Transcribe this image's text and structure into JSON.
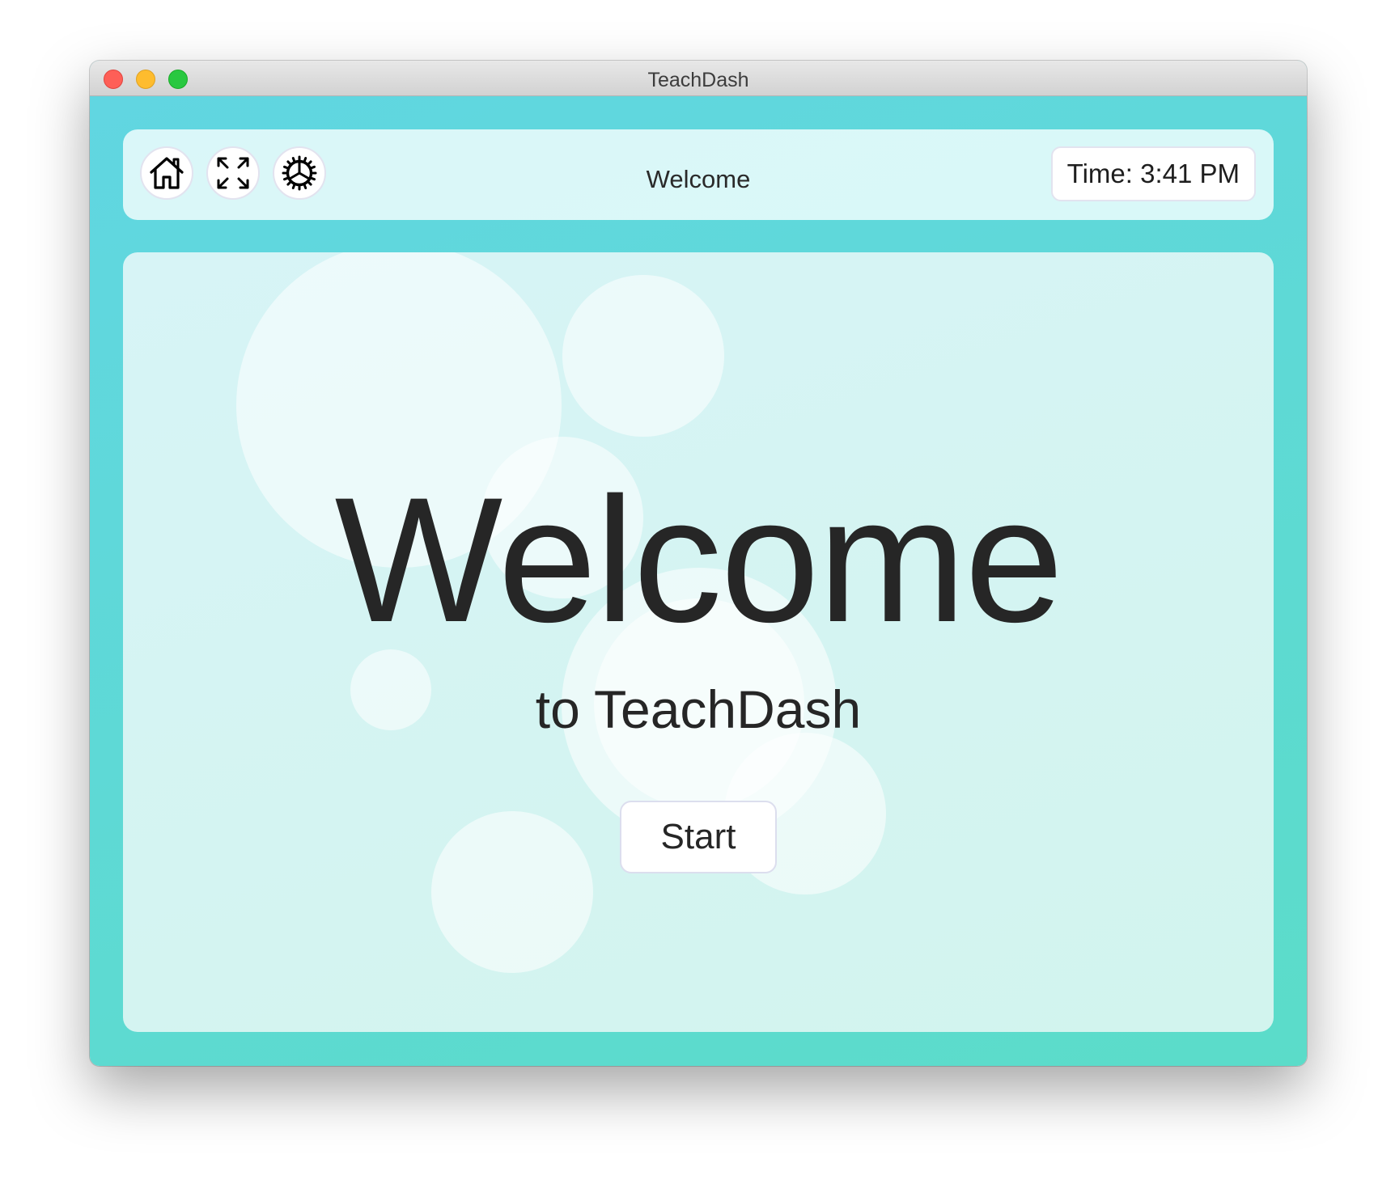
{
  "window": {
    "title": "TeachDash"
  },
  "toolbar": {
    "home_icon": "home-icon",
    "fullscreen_icon": "fullscreen-icon",
    "settings_icon": "gear-icon",
    "page_title": "Welcome",
    "time_label": "Time: 3:41 PM"
  },
  "hero": {
    "title": "Welcome",
    "subtitle": "to TeachDash",
    "start_label": "Start"
  },
  "colors": {
    "background_gradient_start": "#61d6e2",
    "background_gradient_end": "#5bdcc9",
    "card_background": "#d5f4f3",
    "text": "#262626",
    "close": "#fe5f57",
    "minimize": "#febc2e",
    "maximize": "#28c840"
  }
}
